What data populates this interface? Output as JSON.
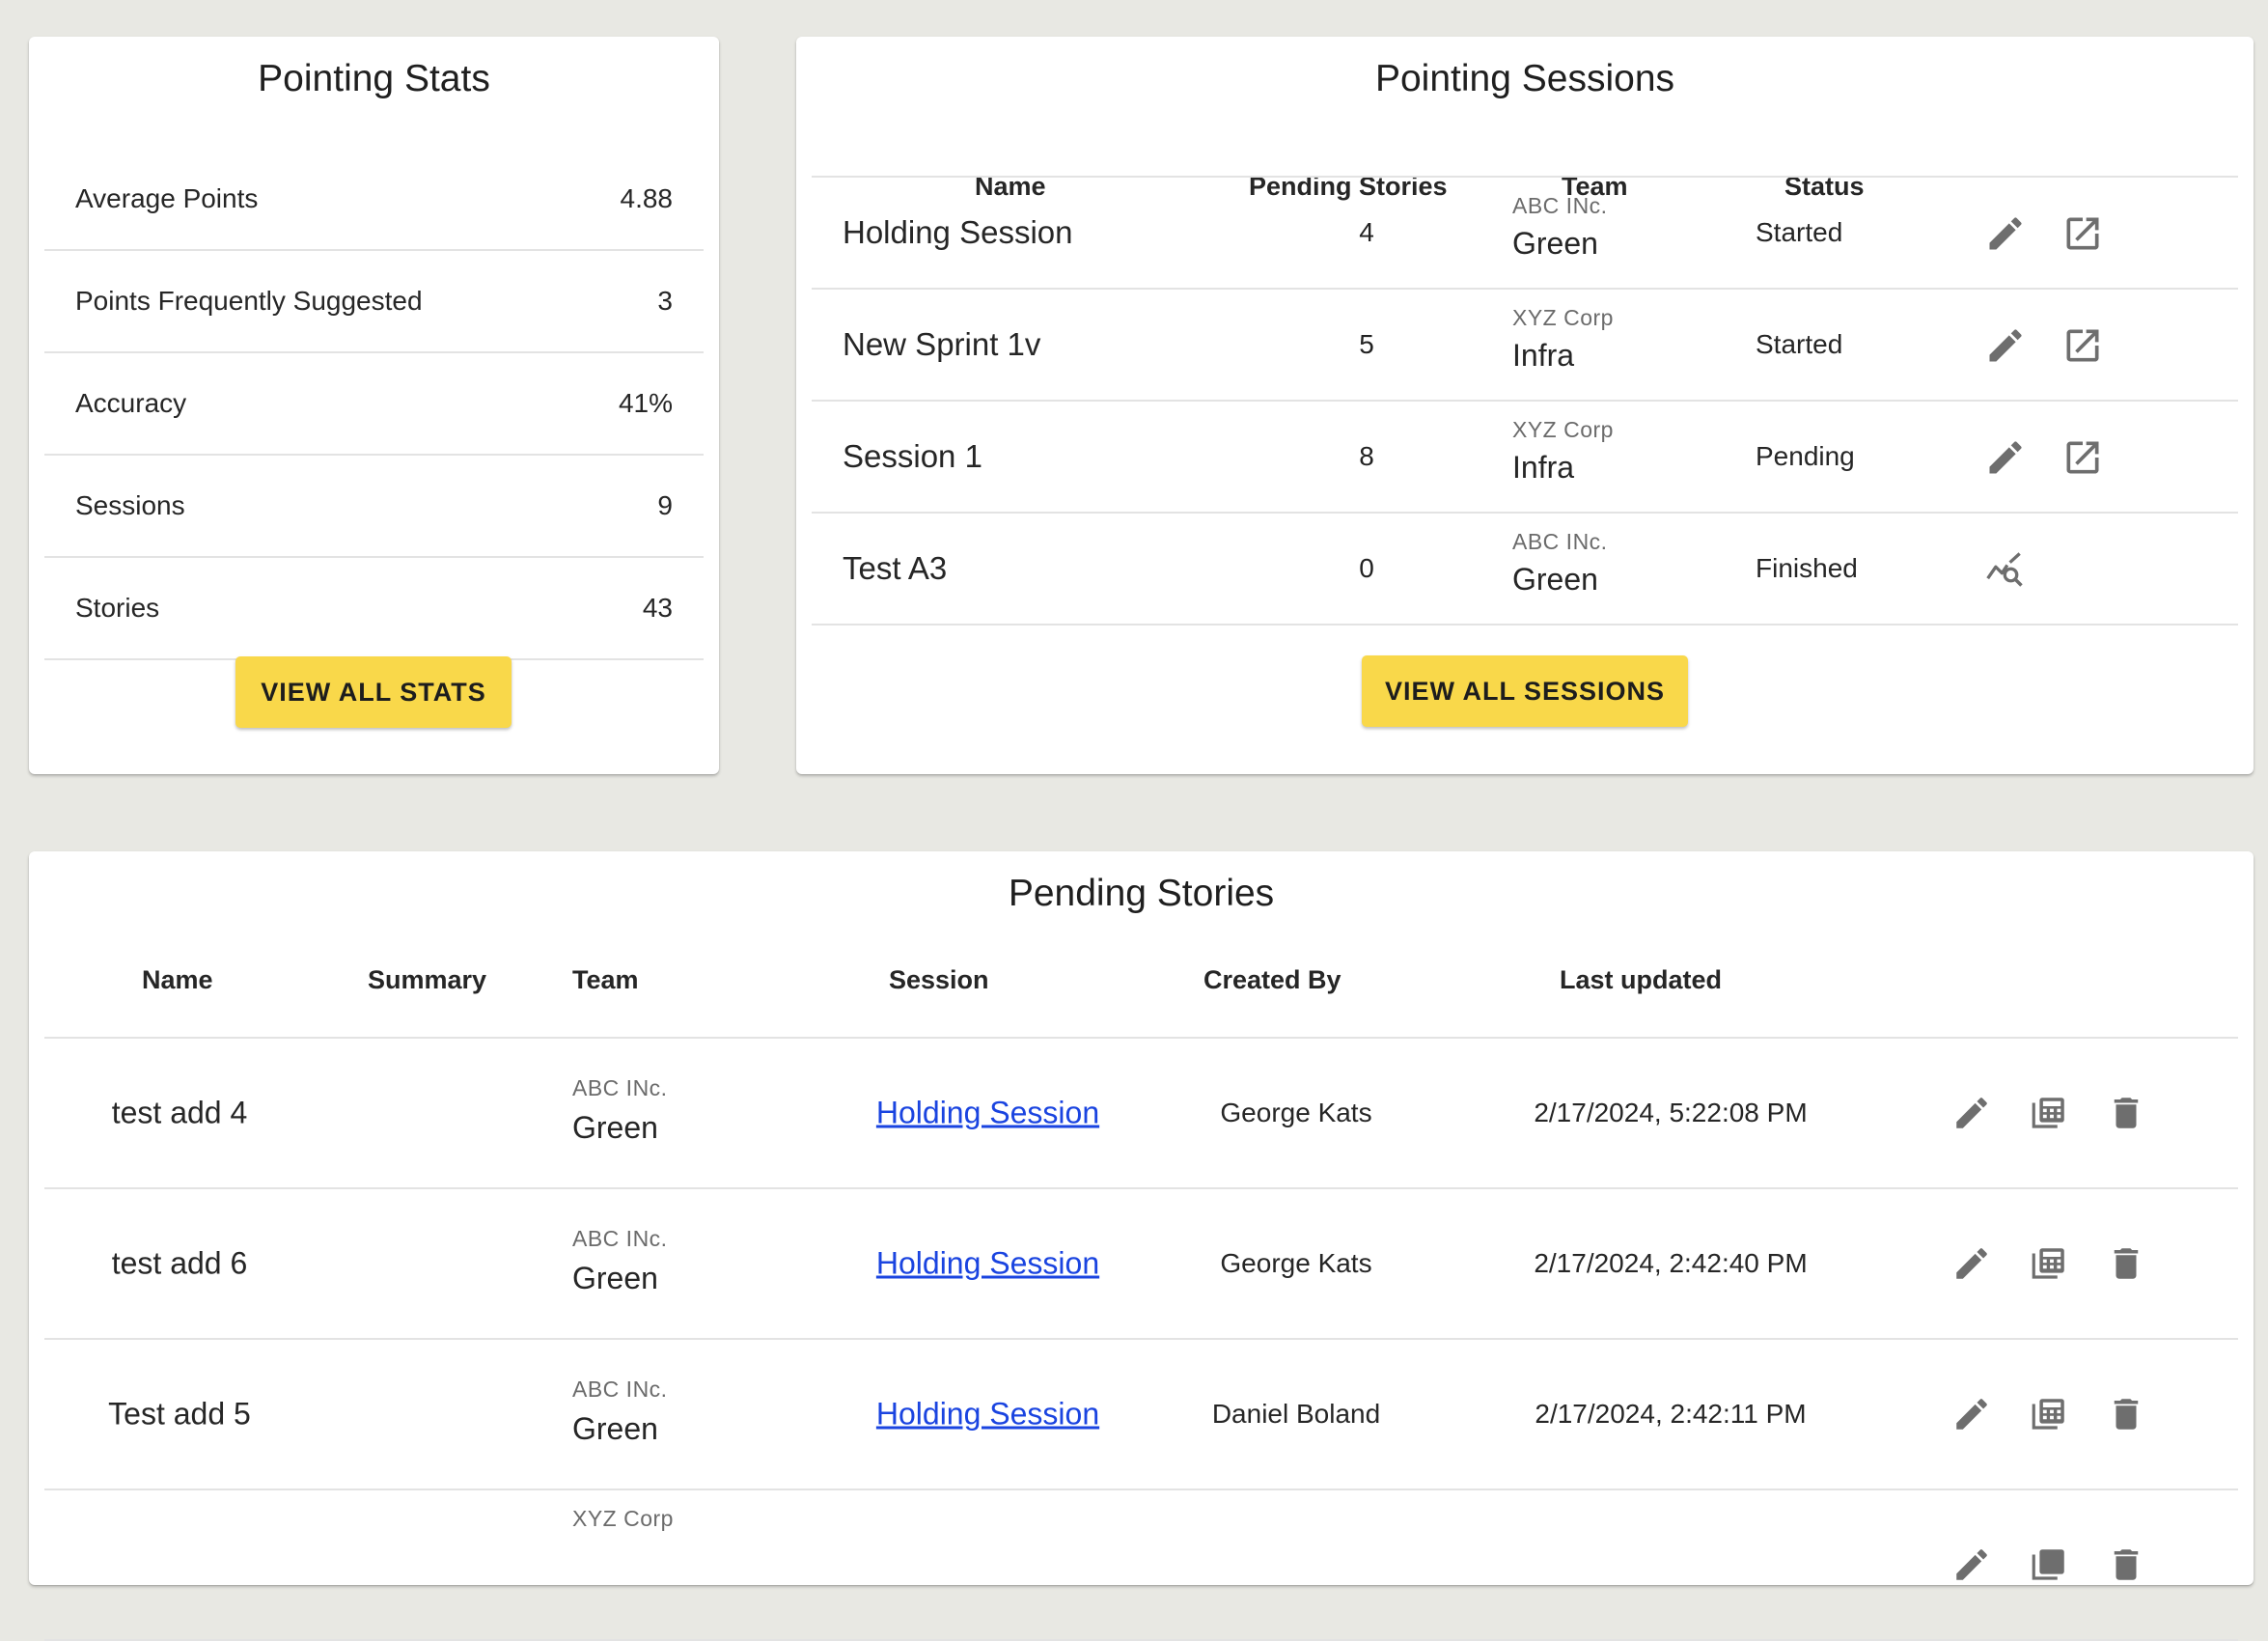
{
  "stats": {
    "title": "Pointing Stats",
    "rows": [
      {
        "label": "Average Points",
        "value": "4.88"
      },
      {
        "label": "Points Frequently Suggested",
        "value": "3"
      },
      {
        "label": "Accuracy",
        "value": "41%"
      },
      {
        "label": "Sessions",
        "value": "9"
      },
      {
        "label": "Stories",
        "value": "43"
      }
    ],
    "button_label": "VIEW ALL STATS"
  },
  "sessions": {
    "title": "Pointing Sessions",
    "headers": {
      "name": "Name",
      "pending": "Pending Stories",
      "team": "Team",
      "status": "Status"
    },
    "rows": [
      {
        "name": "Holding Session",
        "pending": "4",
        "org": "ABC INc.",
        "team": "Green",
        "status": "Started",
        "actions": [
          "edit-icon",
          "open-in-new-icon"
        ]
      },
      {
        "name": "New Sprint 1v",
        "pending": "5",
        "org": "XYZ Corp",
        "team": "Infra",
        "status": "Started",
        "actions": [
          "edit-icon",
          "open-in-new-icon"
        ]
      },
      {
        "name": "Session 1",
        "pending": "8",
        "org": "XYZ Corp",
        "team": "Infra",
        "status": "Pending",
        "actions": [
          "edit-icon",
          "open-in-new-icon"
        ]
      },
      {
        "name": "Test A3",
        "pending": "0",
        "org": "ABC INc.",
        "team": "Green",
        "status": "Finished",
        "actions": [
          "query-stats-icon"
        ]
      }
    ],
    "button_label": "VIEW ALL SESSIONS"
  },
  "stories": {
    "title": "Pending Stories",
    "headers": {
      "name": "Name",
      "summary": "Summary",
      "team": "Team",
      "session": "Session",
      "created_by": "Created By",
      "last_updated": "Last updated"
    },
    "rows": [
      {
        "name": "test add 4",
        "summary": "",
        "org": "ABC INc.",
        "team": "Green",
        "session": "Holding Session",
        "created_by": "George Kats",
        "last_updated": "2/17/2024, 5:22:08 PM"
      },
      {
        "name": "test add 6",
        "summary": "",
        "org": "ABC INc.",
        "team": "Green",
        "session": "Holding Session",
        "created_by": "George Kats",
        "last_updated": "2/17/2024, 2:42:40 PM"
      },
      {
        "name": "Test add 5",
        "summary": "",
        "org": "ABC INc.",
        "team": "Green",
        "session": "Holding Session",
        "created_by": "Daniel Boland",
        "last_updated": "2/17/2024, 2:42:11 PM"
      },
      {
        "name": "",
        "summary": "",
        "org": "XYZ Corp",
        "team": "",
        "session": "",
        "created_by": "",
        "last_updated": ""
      }
    ],
    "row_actions": [
      "edit-icon",
      "calculate-icon",
      "delete-icon"
    ]
  },
  "colors": {
    "background": "#e8e8e3",
    "accent_button": "#f9d84a",
    "link": "#1a44e0",
    "icon": "#6e6e6e"
  }
}
